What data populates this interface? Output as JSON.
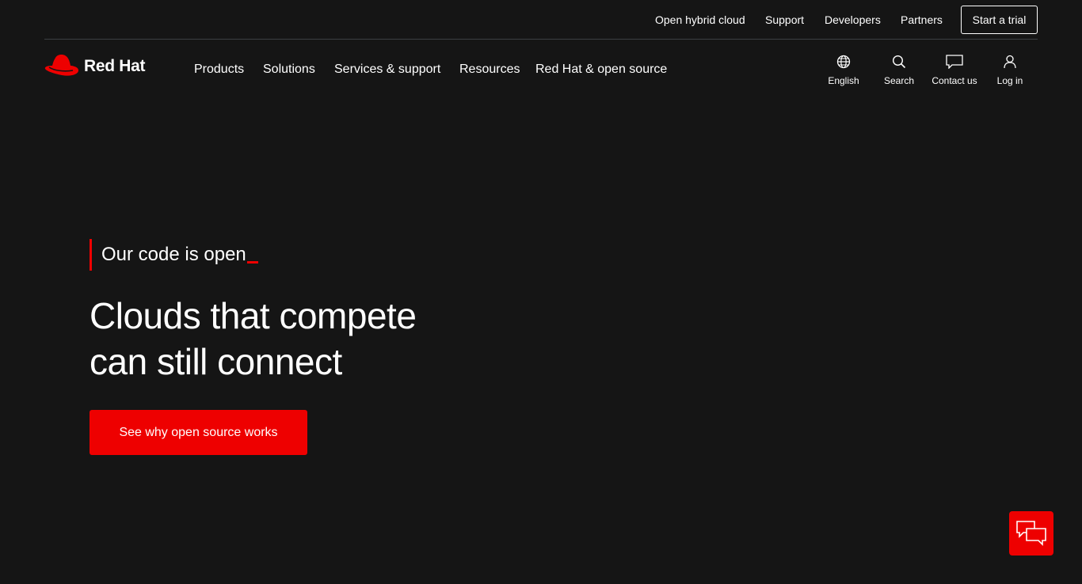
{
  "utility": {
    "links": [
      "Open hybrid cloud",
      "Support",
      "Developers",
      "Partners"
    ],
    "cta": "Start a trial"
  },
  "brand": {
    "name": "Red Hat"
  },
  "nav": {
    "items": [
      "Products",
      "Solutions",
      "Services & support",
      "Resources",
      "Red Hat & open source"
    ]
  },
  "tools": {
    "language": {
      "label": "English",
      "icon": "globe-icon"
    },
    "search": {
      "label": "Search",
      "icon": "search-icon"
    },
    "contact": {
      "label": "Contact us",
      "icon": "chat-bubble-icon"
    },
    "login": {
      "label": "Log in",
      "icon": "user-icon"
    }
  },
  "hero": {
    "eyebrow": "Our code is open",
    "title_line1": "Clouds that compete",
    "title_line2": "can still connect",
    "cta": "See why open source works"
  },
  "colors": {
    "background": "#151515",
    "accent": "#ee0000",
    "text": "#ffffff"
  }
}
